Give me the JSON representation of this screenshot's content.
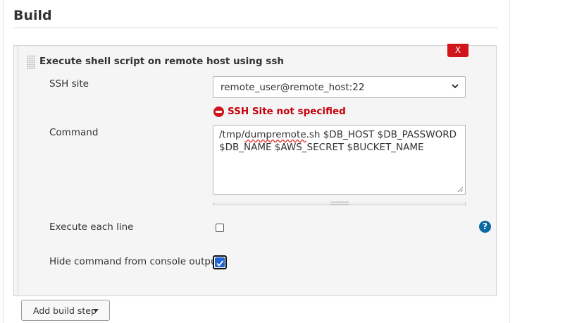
{
  "section": {
    "title": "Build"
  },
  "step": {
    "title": "Execute shell script on remote host using ssh",
    "delete_label": "X"
  },
  "ssh_site": {
    "label": "SSH site",
    "selected": "remote_user@remote_host:22",
    "error": "SSH Site not specified"
  },
  "command": {
    "label": "Command",
    "lines": [
      {
        "misspelled": "dumpremote",
        "pre": "/tmp/",
        "post": ".sh $DB_HOST $DB_PASSWORD"
      },
      {
        "text": "$DB_NAME $AWS_SECRET $BUCKET_NAME"
      }
    ]
  },
  "execute_each_line": {
    "label": "Execute each line",
    "checked": false,
    "help": "?"
  },
  "hide_command": {
    "label": "Hide command from console output",
    "checked": true
  },
  "add_build_step": {
    "label": "Add build step"
  },
  "colors": {
    "error_red": "#c4000a",
    "delete_red": "#d2141b",
    "help_blue": "#0b6aa2",
    "checkbox_blue": "#1f65d6"
  },
  "icons": [
    "drag-handle-icon",
    "error-icon",
    "chevron-down-icon",
    "help-icon",
    "caret-down-icon"
  ]
}
